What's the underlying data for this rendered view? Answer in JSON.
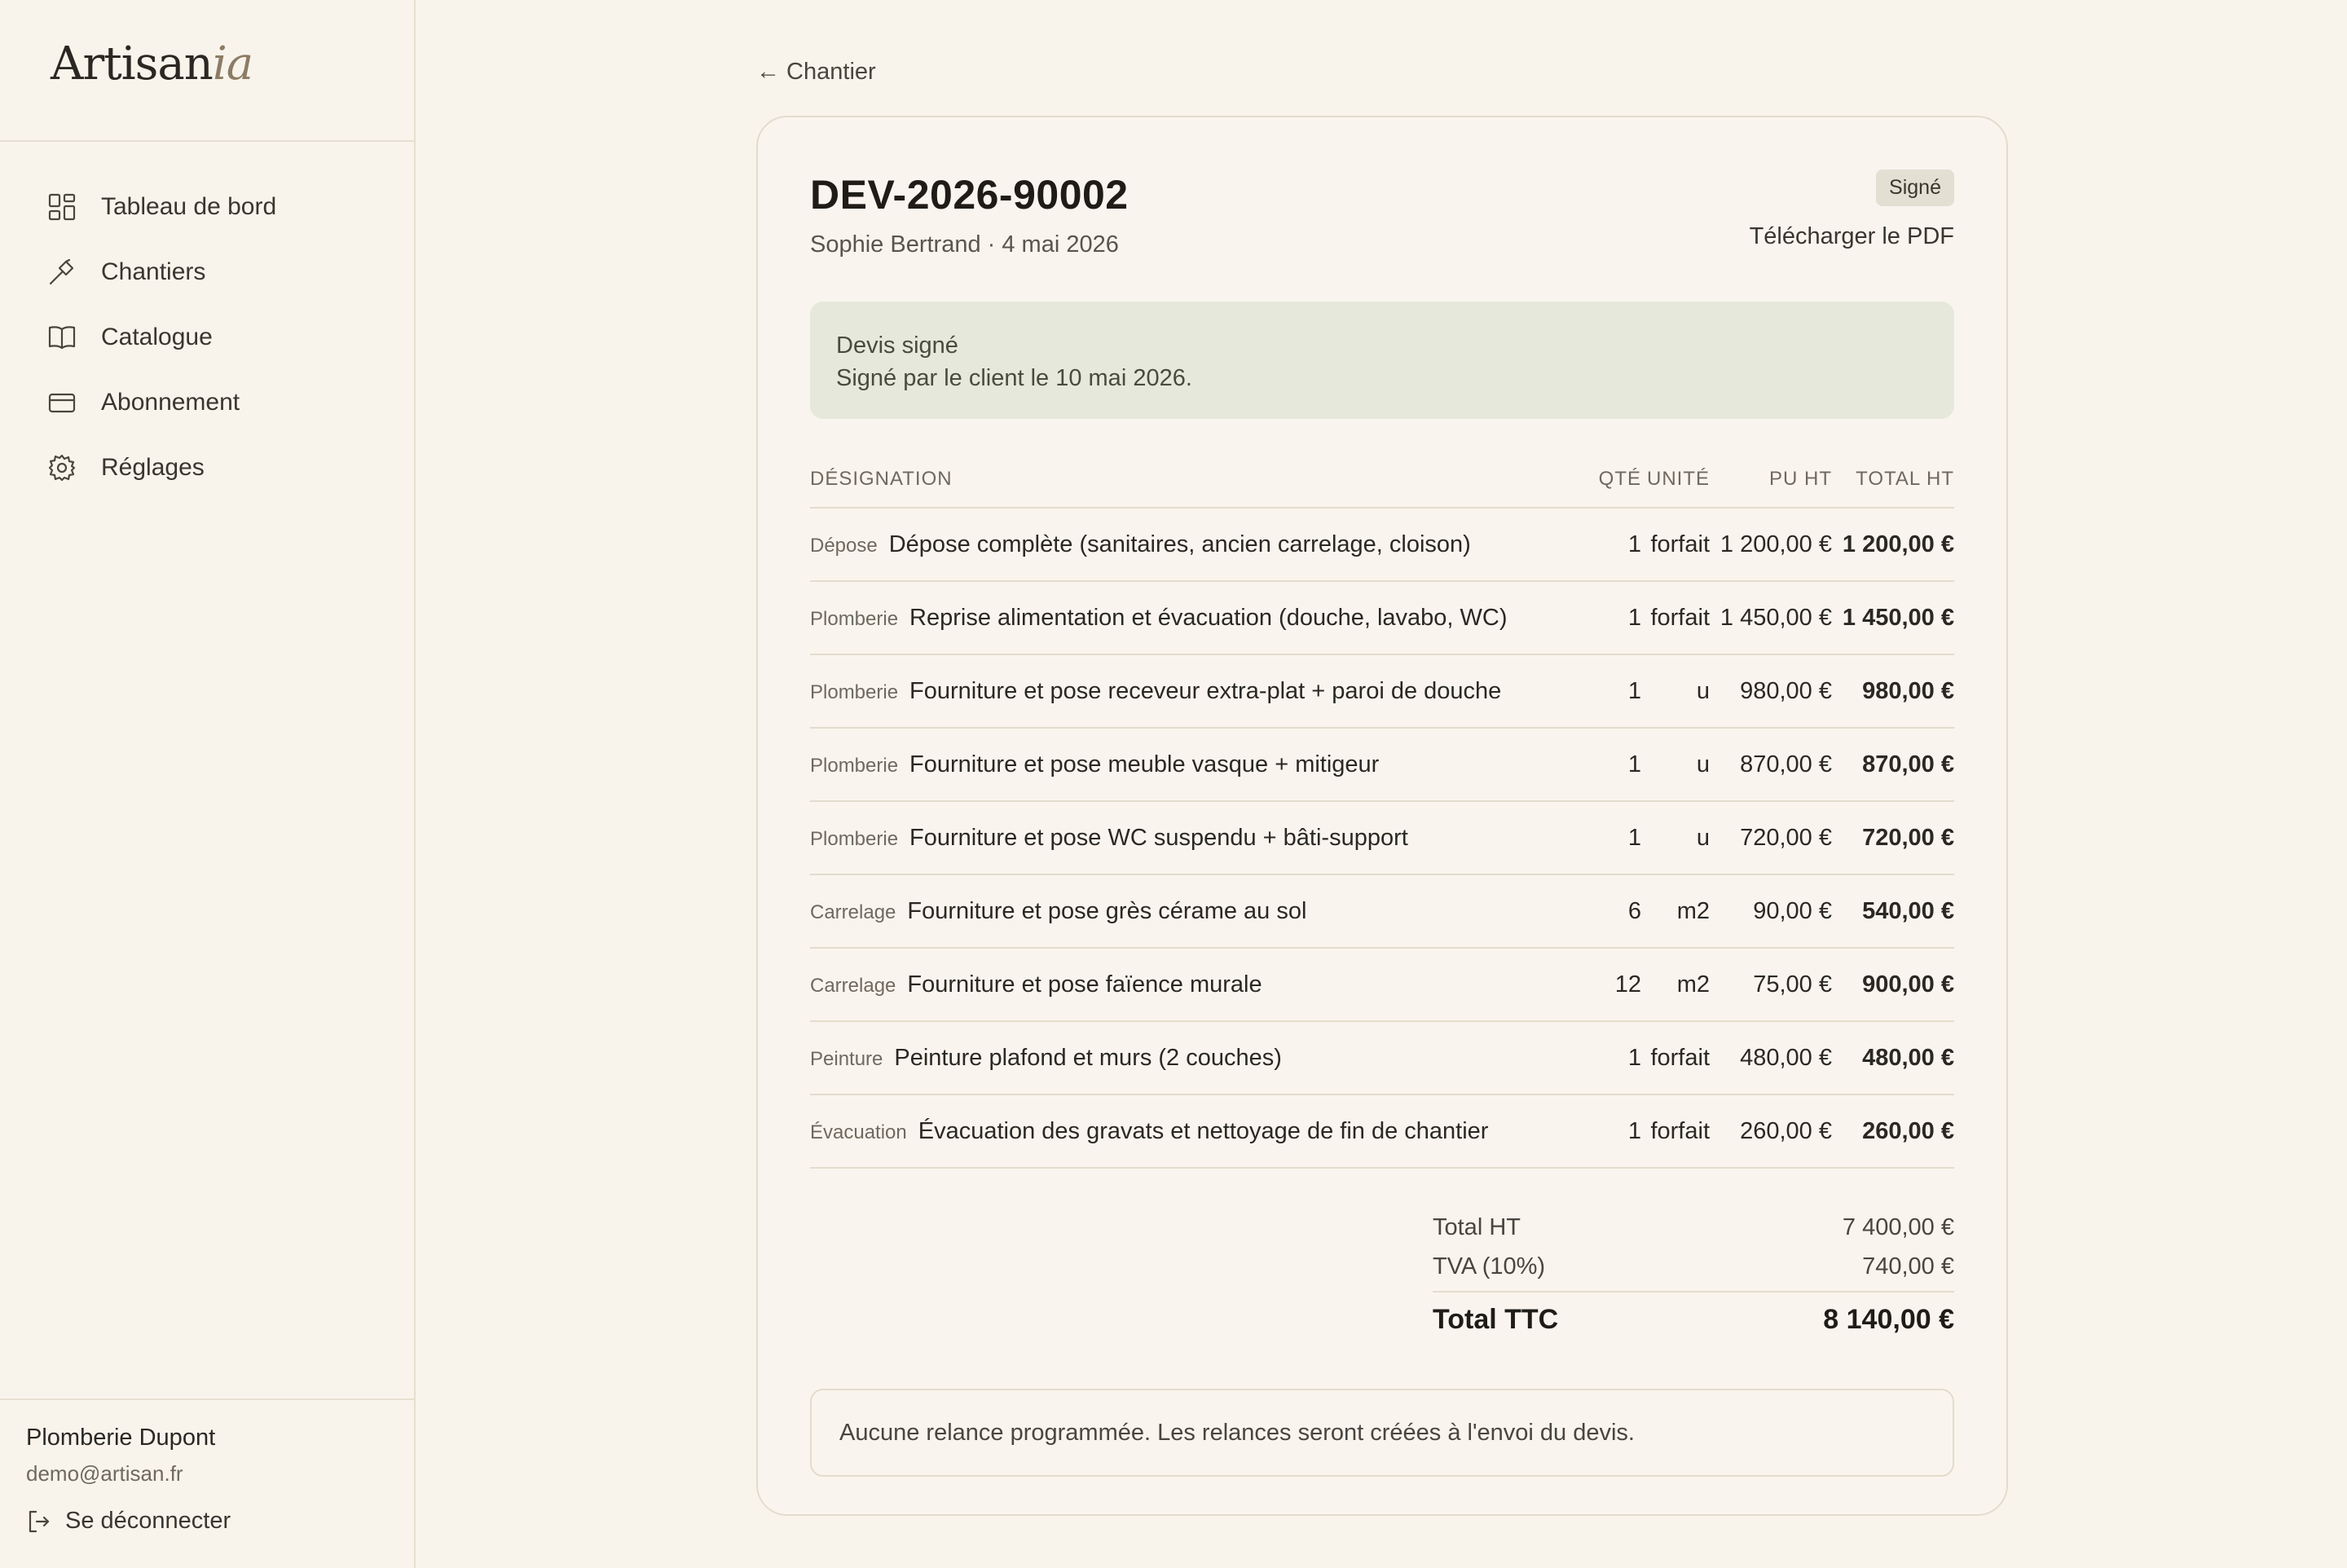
{
  "brand": {
    "name_main": "Artisan",
    "name_accent": "ia"
  },
  "nav": [
    {
      "label": "Tableau de bord",
      "icon": "dashboard-icon"
    },
    {
      "label": "Chantiers",
      "icon": "hammer-icon"
    },
    {
      "label": "Catalogue",
      "icon": "book-icon"
    },
    {
      "label": "Abonnement",
      "icon": "credit-card-icon"
    },
    {
      "label": "Réglages",
      "icon": "gear-icon"
    }
  ],
  "account": {
    "company": "Plomberie Dupont",
    "email": "demo@artisan.fr",
    "logout_label": "Se déconnecter"
  },
  "back_link": "← Chantier",
  "quote": {
    "number": "DEV-2026-90002",
    "subtitle": "Sophie Bertrand · 4 mai 2026",
    "status_badge": "Signé",
    "pdf_link": "Télécharger le PDF",
    "signed_title": "Devis signé",
    "signed_text": "Signé par le client le 10 mai 2026.",
    "columns": {
      "designation": "DÉSIGNATION",
      "qty": "QTÉ",
      "unit": "UNITÉ",
      "pu": "PU HT",
      "total": "TOTAL HT"
    },
    "lines": [
      {
        "category": "Dépose",
        "label": "Dépose complète (sanitaires, ancien carrelage, cloison)",
        "qty": "1",
        "unit": "forfait",
        "pu": "1 200,00 €",
        "total": "1 200,00 €"
      },
      {
        "category": "Plomberie",
        "label": "Reprise alimentation et évacuation (douche, lavabo, WC)",
        "qty": "1",
        "unit": "forfait",
        "pu": "1 450,00 €",
        "total": "1 450,00 €"
      },
      {
        "category": "Plomberie",
        "label": "Fourniture et pose receveur extra-plat + paroi de douche",
        "qty": "1",
        "unit": "u",
        "pu": "980,00 €",
        "total": "980,00 €"
      },
      {
        "category": "Plomberie",
        "label": "Fourniture et pose meuble vasque + mitigeur",
        "qty": "1",
        "unit": "u",
        "pu": "870,00 €",
        "total": "870,00 €"
      },
      {
        "category": "Plomberie",
        "label": "Fourniture et pose WC suspendu + bâti-support",
        "qty": "1",
        "unit": "u",
        "pu": "720,00 €",
        "total": "720,00 €"
      },
      {
        "category": "Carrelage",
        "label": "Fourniture et pose grès cérame au sol",
        "qty": "6",
        "unit": "m2",
        "pu": "90,00 €",
        "total": "540,00 €"
      },
      {
        "category": "Carrelage",
        "label": "Fourniture et pose faïence murale",
        "qty": "12",
        "unit": "m2",
        "pu": "75,00 €",
        "total": "900,00 €"
      },
      {
        "category": "Peinture",
        "label": "Peinture plafond et murs (2 couches)",
        "qty": "1",
        "unit": "forfait",
        "pu": "480,00 €",
        "total": "480,00 €"
      },
      {
        "category": "Évacuation",
        "label": "Évacuation des gravats et nettoyage de fin de chantier",
        "qty": "1",
        "unit": "forfait",
        "pu": "260,00 €",
        "total": "260,00 €"
      }
    ],
    "totals": {
      "ht_label": "Total HT",
      "ht_value": "7 400,00 €",
      "tva_label": "TVA (10%)",
      "tva_value": "740,00 €",
      "ttc_label": "Total TTC",
      "ttc_value": "8 140,00 €"
    },
    "reminder_text": "Aucune relance programmée. Les relances seront créées à l'envoi du devis."
  },
  "colors": {
    "background": "#f8f4ec",
    "signed_box": "#e6e8dc",
    "badge": "#e3dfd3",
    "logo_accent": "#8c7c64"
  }
}
